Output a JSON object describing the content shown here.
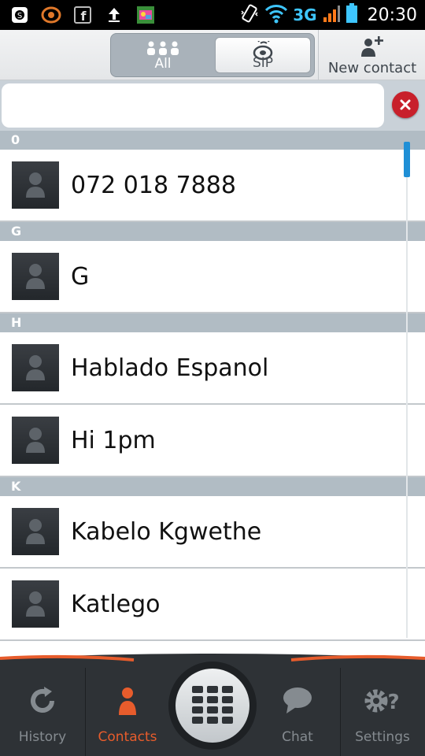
{
  "status_bar": {
    "network": "3G",
    "time": "20:30",
    "icons": [
      "skype-icon",
      "browser-icon",
      "facebook-icon",
      "upload-icon",
      "photo-app-icon",
      "vibrate-icon",
      "wifi-icon",
      "signal-icon",
      "battery-icon"
    ]
  },
  "toolbar": {
    "tabs": [
      {
        "label": "All",
        "icon": "people-icon",
        "selected": true
      },
      {
        "label": "SIP",
        "icon": "sip-icon",
        "selected": false
      }
    ],
    "new_contact_label": "New contact"
  },
  "search": {
    "value": "",
    "placeholder": ""
  },
  "contacts": {
    "sections": [
      {
        "letter": "0",
        "items": [
          {
            "name": "072 018 7888"
          }
        ]
      },
      {
        "letter": "G",
        "items": [
          {
            "name": "G"
          }
        ]
      },
      {
        "letter": "H",
        "items": [
          {
            "name": "Hablado Espanol"
          },
          {
            "name": "Hi 1pm"
          }
        ]
      },
      {
        "letter": "K",
        "items": [
          {
            "name": "Kabelo Kgwethe"
          },
          {
            "name": "Katlego"
          }
        ]
      }
    ]
  },
  "bottom_nav": {
    "items": [
      {
        "label": "History",
        "icon": "history-icon",
        "active": false
      },
      {
        "label": "Contacts",
        "icon": "contacts-icon",
        "active": true
      },
      {
        "label": "Chat",
        "icon": "chat-icon",
        "active": false
      },
      {
        "label": "Settings",
        "icon": "settings-icon",
        "active": false
      }
    ],
    "center_icon": "dialpad-icon"
  },
  "colors": {
    "accent": "#e75c2c",
    "section_header": "#b1bcc4",
    "scrollbar": "#1f8fd6",
    "clear_button": "#c8202b",
    "nav_background": "#2e3236"
  }
}
